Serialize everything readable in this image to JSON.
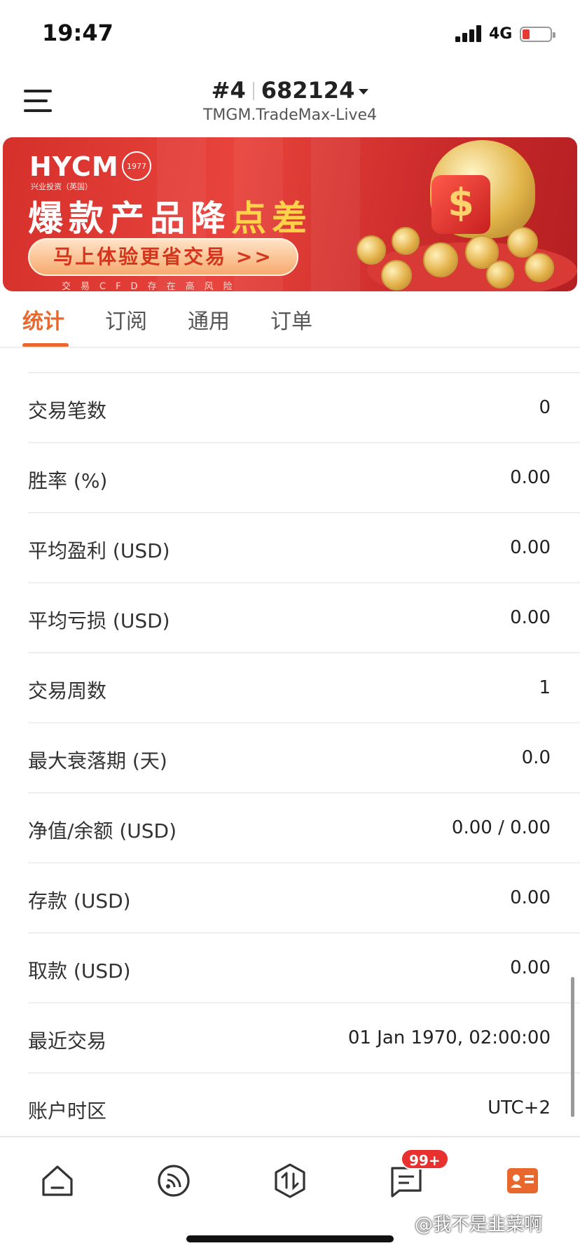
{
  "status_bar": {
    "time": "19:47",
    "network": "4G"
  },
  "header": {
    "account_prefix": "#4",
    "account_number": "682124",
    "server": "TMGM.TradeMax-Live4"
  },
  "banner": {
    "brand": "HYCM",
    "brand_sub": "兴业投资（英国）",
    "seal": "1977",
    "headline_main": "爆款产品降",
    "headline_highlight": "点差",
    "cta": "马上体验更省交易 >>",
    "disclaimer": "交易CFD存在高风险"
  },
  "tabs": [
    "统计",
    "订阅",
    "通用",
    "订单"
  ],
  "active_tab": "统计",
  "stats": [
    {
      "label": "交易笔数",
      "value": "0"
    },
    {
      "label": "胜率 (%)",
      "value": "0.00"
    },
    {
      "label": "平均盈利 (USD)",
      "value": "0.00"
    },
    {
      "label": "平均亏损 (USD)",
      "value": "0.00"
    },
    {
      "label": "交易周数",
      "value": "1"
    },
    {
      "label": "最大衰落期 (天)",
      "value": "0.0"
    },
    {
      "label": "净值/余额 (USD)",
      "value": "0.00 / 0.00"
    },
    {
      "label": "存款 (USD)",
      "value": "0.00"
    },
    {
      "label": "取款 (USD)",
      "value": "0.00"
    },
    {
      "label": "最近交易",
      "value": "01 Jan 1970, 02:00:00"
    },
    {
      "label": "账户时区",
      "value": "UTC+2"
    }
  ],
  "bottom_nav": {
    "items": [
      "home-icon",
      "signal-feed-icon",
      "trade-icon",
      "messages-icon",
      "profile-card-icon"
    ],
    "badge": "99+",
    "accent": "#E8672C"
  },
  "watermark": "@我不是韭菜啊"
}
